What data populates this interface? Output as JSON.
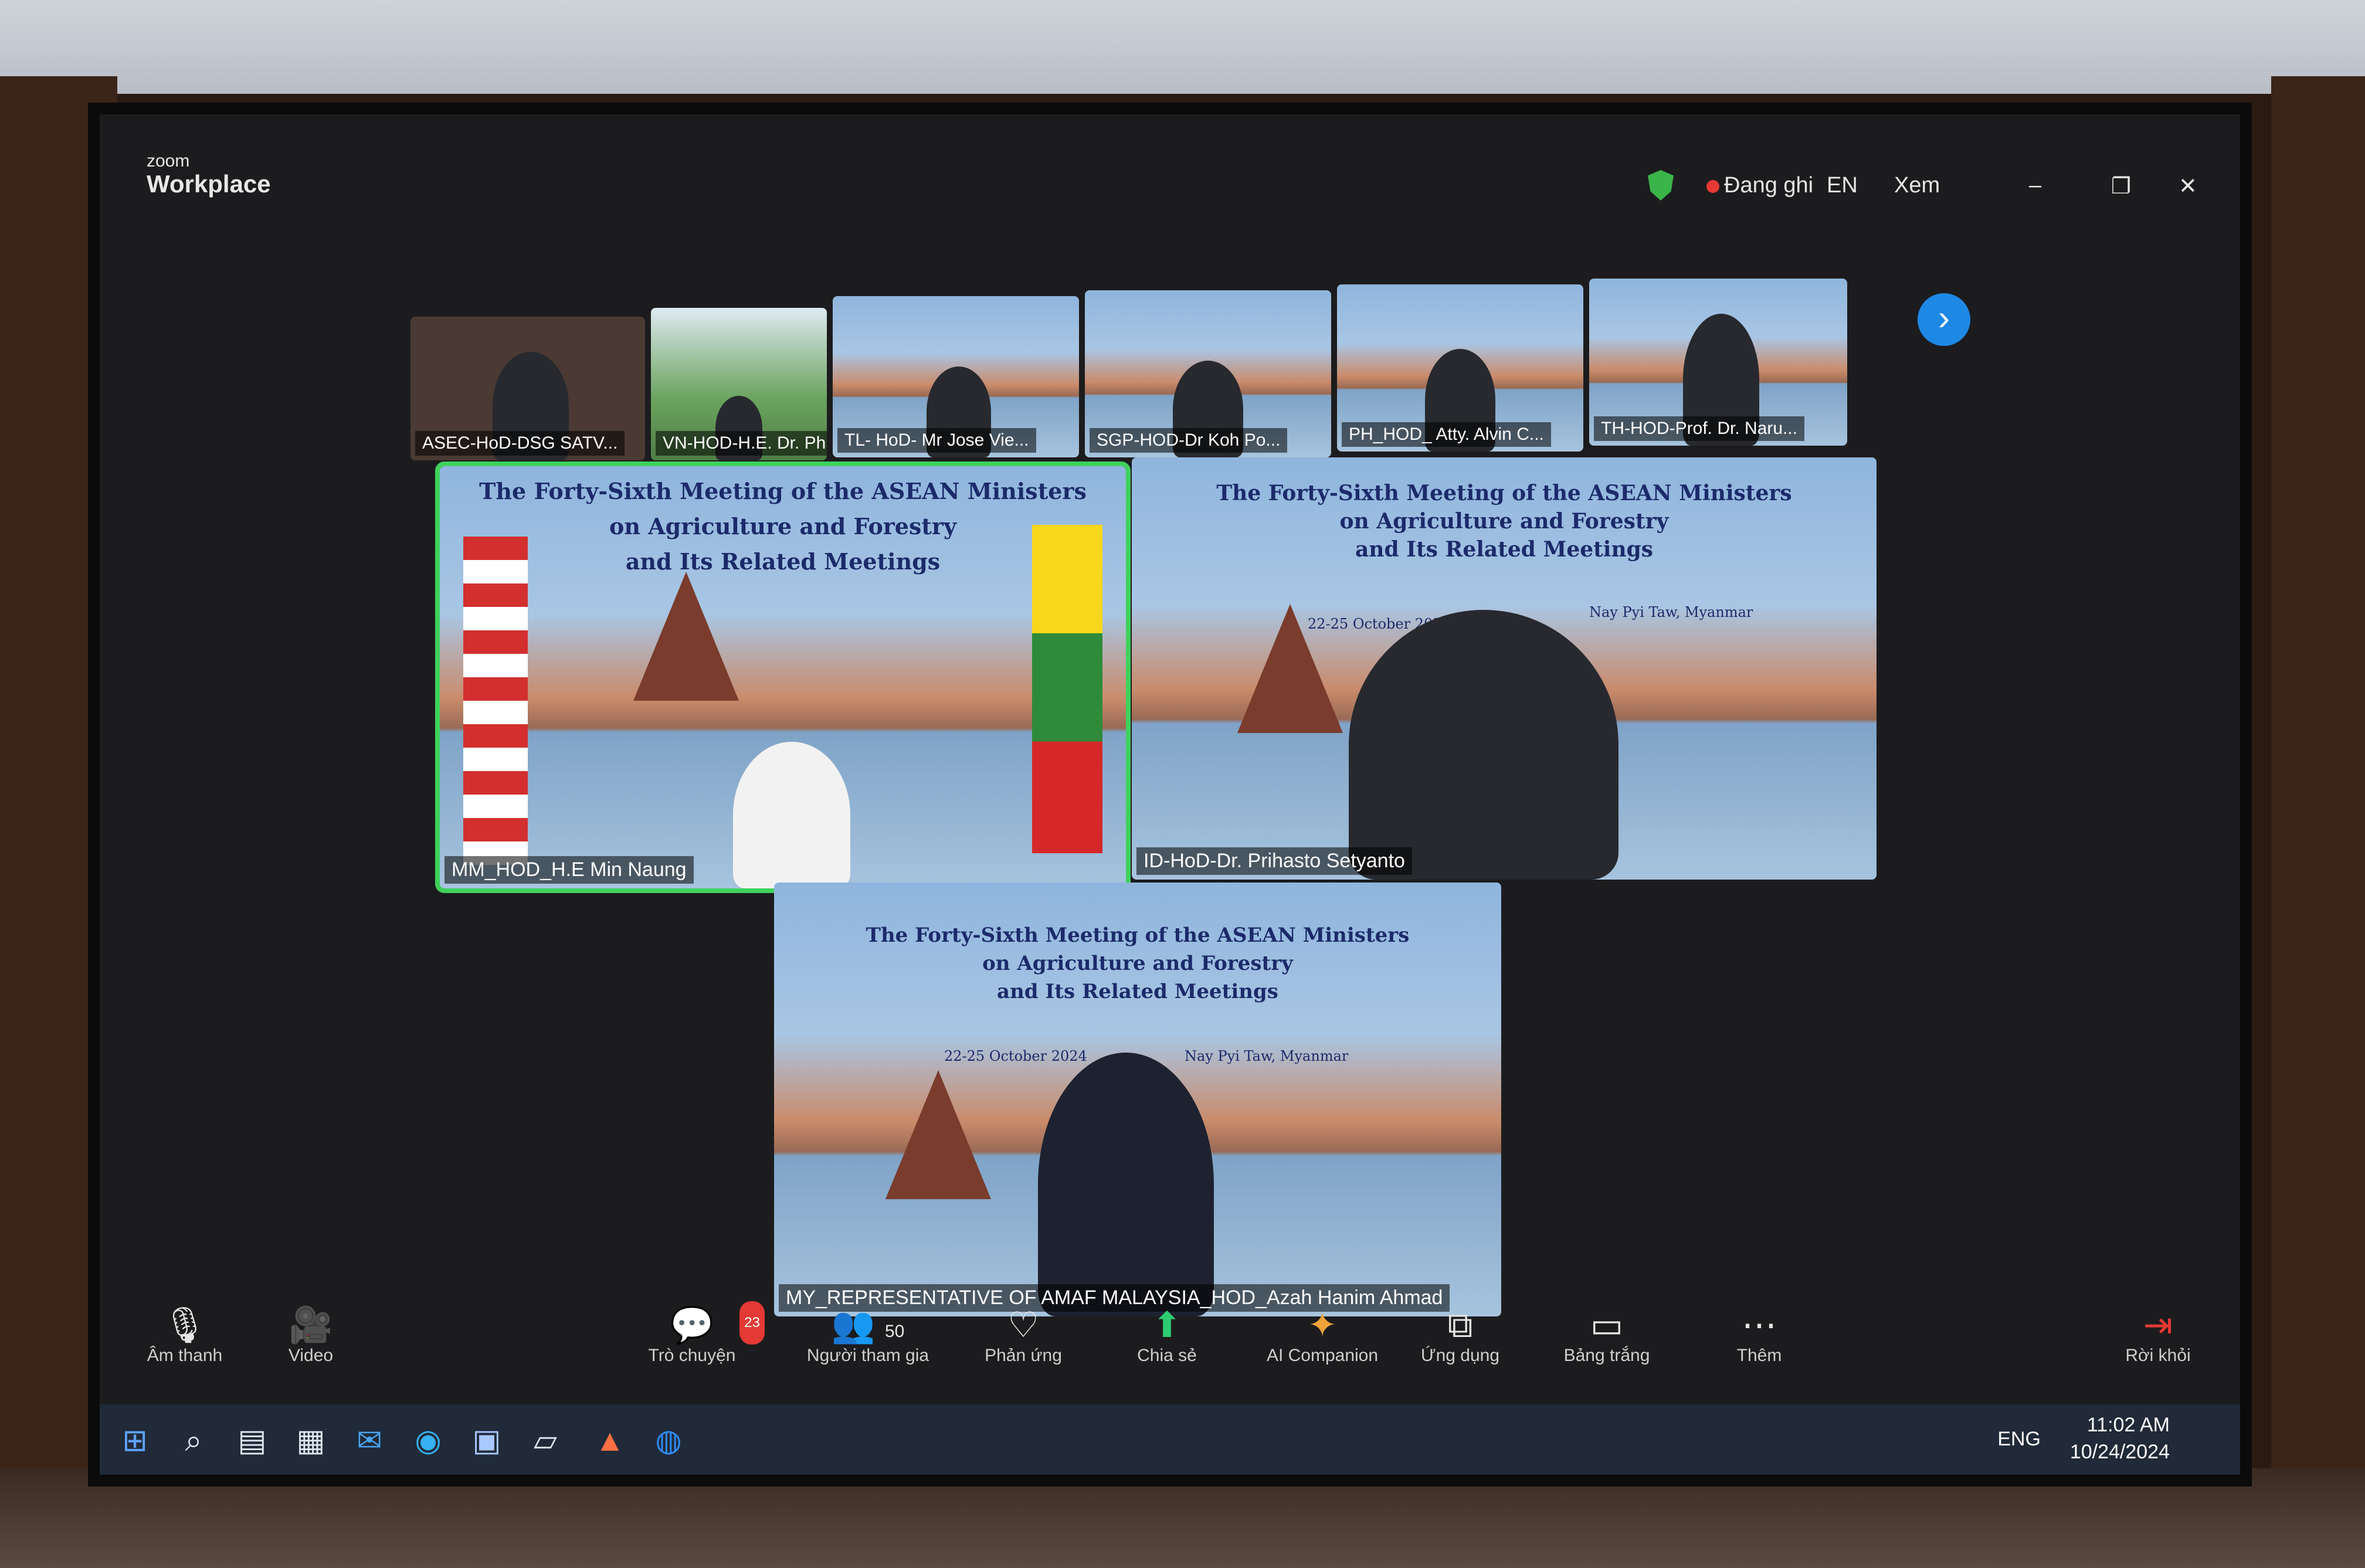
{
  "app": {
    "brand_small": "zoom",
    "brand_large": "Workplace"
  },
  "topbar": {
    "recording_label": "Đang ghi",
    "language_label": "EN",
    "view_label": "Xem",
    "minimize": "–",
    "restore": "❐",
    "close": "✕"
  },
  "gallery": [
    {
      "name": "ASEC-HoD-DSG SATV..."
    },
    {
      "name": "VN-HOD-H.E. Dr. Phung..."
    },
    {
      "name": "TL- HoD- Mr Jose Vie..."
    },
    {
      "name": "SGP-HOD-Dr Koh Po..."
    },
    {
      "name": "PH_HOD_ Atty. Alvin C..."
    },
    {
      "name": "TH-HOD-Prof. Dr. Naru..."
    }
  ],
  "gallery_next_label": "›",
  "meeting_banner": {
    "line1": "The Forty-Sixth Meeting of the ASEAN Ministers",
    "line2": "on Agriculture and Forestry",
    "line3": "and Its Related Meetings",
    "dates": "22-25 October 2024",
    "venue": "Nay Pyi Taw, Myanmar"
  },
  "main_tiles": [
    {
      "name": "MM_HOD_H.E Min Naung"
    },
    {
      "name": "ID-HoD-Dr. Prihasto Setyanto"
    },
    {
      "name": "MY_REPRESENTATIVE OF AMAF MALAYSIA_HOD_Azah Hanim Ahmad"
    }
  ],
  "toolbar": {
    "audio": "Âm thanh",
    "video": "Video",
    "chat": "Trò chuyện",
    "chat_badge": "23",
    "participants": "Người tham gia",
    "participants_count": "50",
    "reactions": "Phản ứng",
    "share": "Chia sẻ",
    "ai": "AI Companion",
    "apps": "Ứng dụng",
    "whiteboard": "Bảng trắng",
    "more": "Thêm",
    "leave": "Rời khỏi"
  },
  "taskbar": {
    "lang": "ENG",
    "time": "11:02 AM",
    "date": "10/24/2024"
  },
  "colors": {
    "active_speaker": "#3fd15c",
    "share": "#2ecc71",
    "leave": "#e53935"
  }
}
